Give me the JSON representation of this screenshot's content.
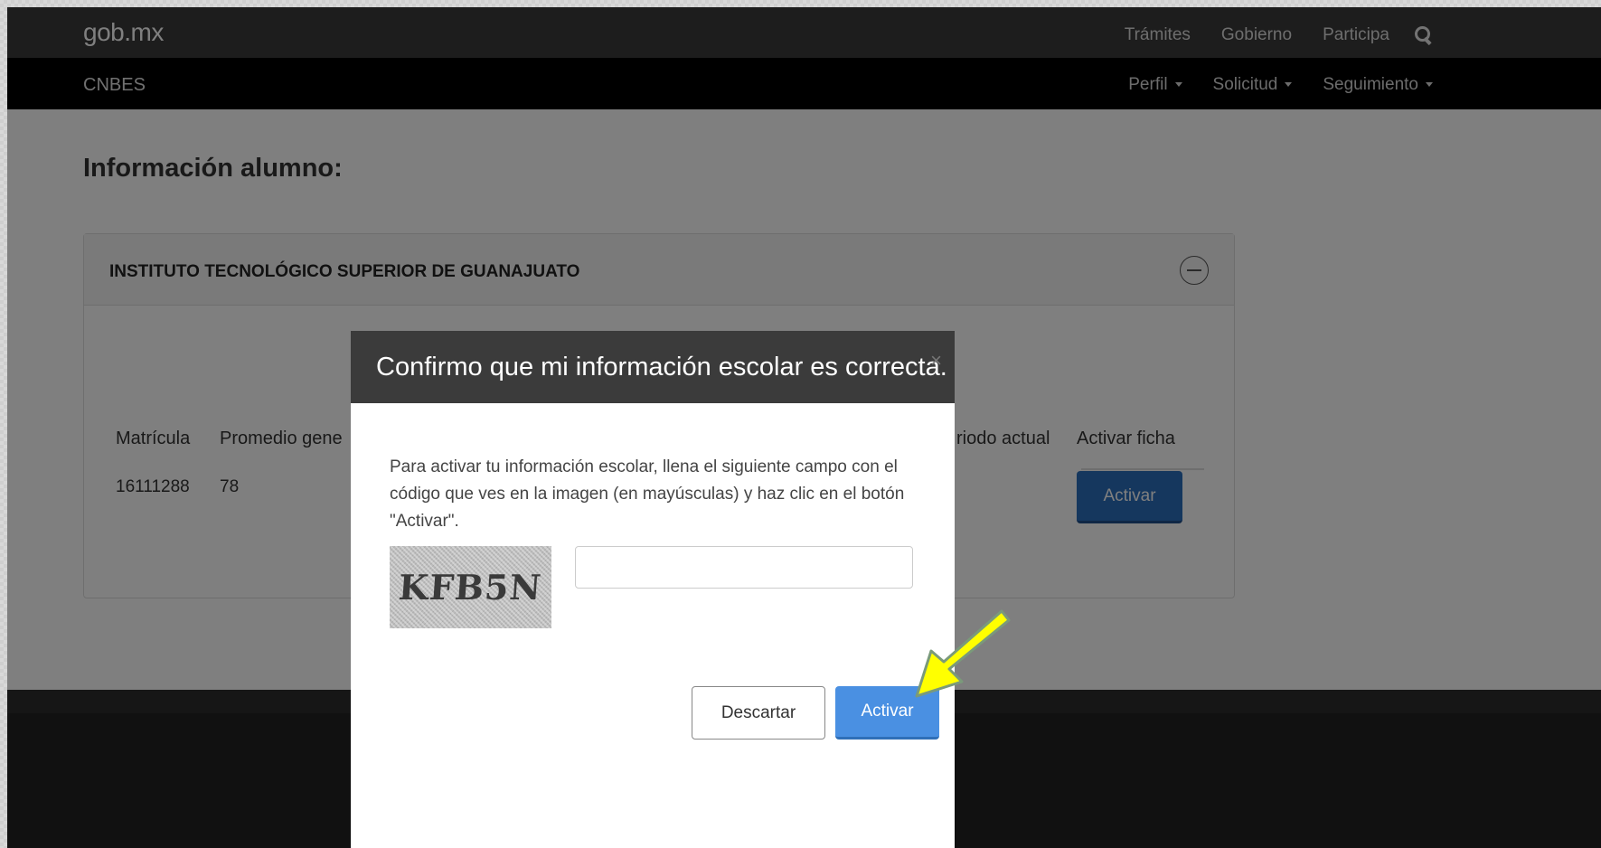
{
  "header": {
    "brand": "gob.mx",
    "nav": [
      "Trámites",
      "Gobierno",
      "Participa"
    ]
  },
  "subheader": {
    "brand": "CNBES",
    "menus": [
      "Perfil",
      "Solicitud",
      "Seguimiento"
    ]
  },
  "page": {
    "title": "Información alumno:"
  },
  "panel": {
    "title": "INSTITUTO TECNOLÓGICO SUPERIOR DE GUANAJUATO",
    "columns": {
      "matricula": "Matrícula",
      "promedio": "Promedio gene",
      "periodo": "riodo actual",
      "activar": "Activar ficha"
    },
    "row": {
      "matricula": "16111288",
      "promedio": "78"
    },
    "activate_button": "Activar"
  },
  "modal": {
    "title": "Confirmo que mi información escolar es correcta.",
    "close": "×",
    "instructions": "Para activar tu información escolar, llena el siguiente campo con el código que ves en la imagen (en mayúsculas) y haz clic en el botón \"Activar\".",
    "captcha_text": "KFB5N",
    "captcha_input_value": "",
    "discard_label": "Descartar",
    "activate_label": "Activar"
  },
  "colors": {
    "primary_button": "#4a90e2",
    "header_bg": "#3a3a3a",
    "subheader_bg": "#000000",
    "annotation_arrow": "#ffff00"
  }
}
